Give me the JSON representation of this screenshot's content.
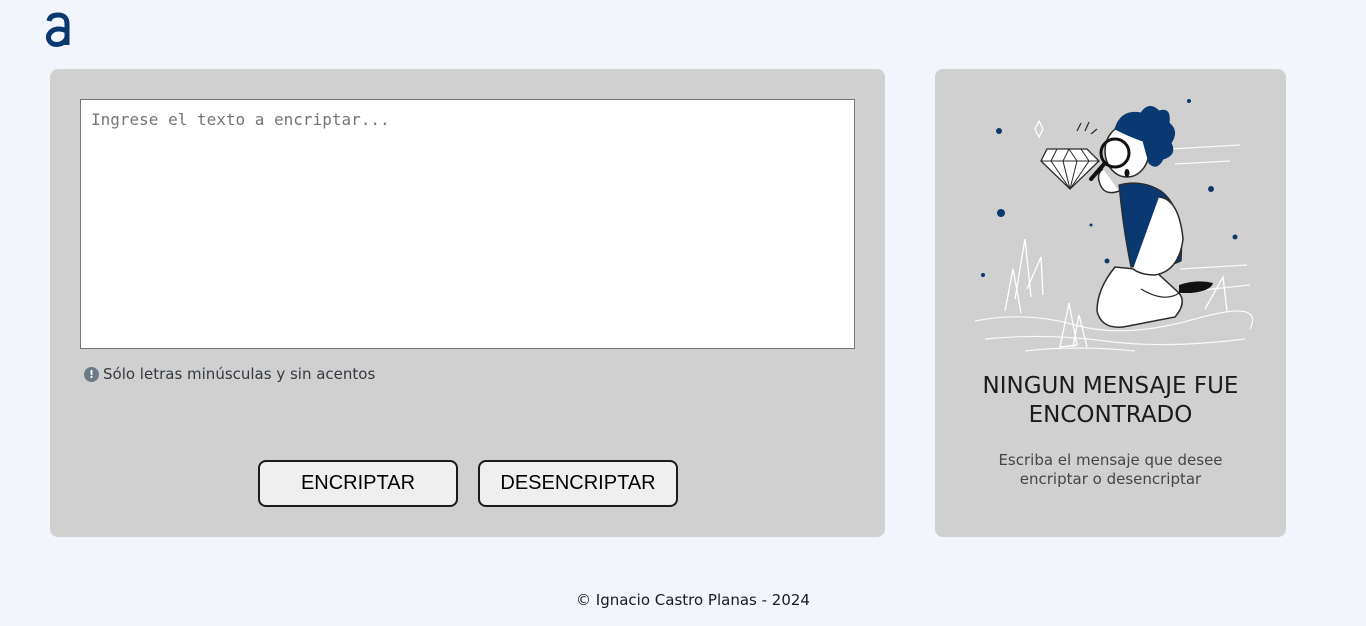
{
  "logo": {
    "icon": "alura-logo-icon",
    "color": "#0a3871"
  },
  "input": {
    "placeholder": "Ingrese el texto a encriptar...",
    "value": ""
  },
  "hint": {
    "icon": "exclamation-circle-icon",
    "text": "Sólo letras minúsculas y sin acentos"
  },
  "buttons": {
    "encrypt_label": "ENCRIPTAR",
    "decrypt_label": "DESENCRIPTAR"
  },
  "result": {
    "illustration": "person-with-magnifying-glass-illustration",
    "title": "NINGUN MENSAJE FUE ENCONTRADO",
    "description": "Escriba el mensaje que desee encriptar o desencriptar"
  },
  "footer": {
    "text": "© Ignacio Castro Planas - 2024"
  },
  "colors": {
    "background": "#f2f5fc",
    "panel": "#d0d0d0",
    "accent": "#0a3871"
  }
}
